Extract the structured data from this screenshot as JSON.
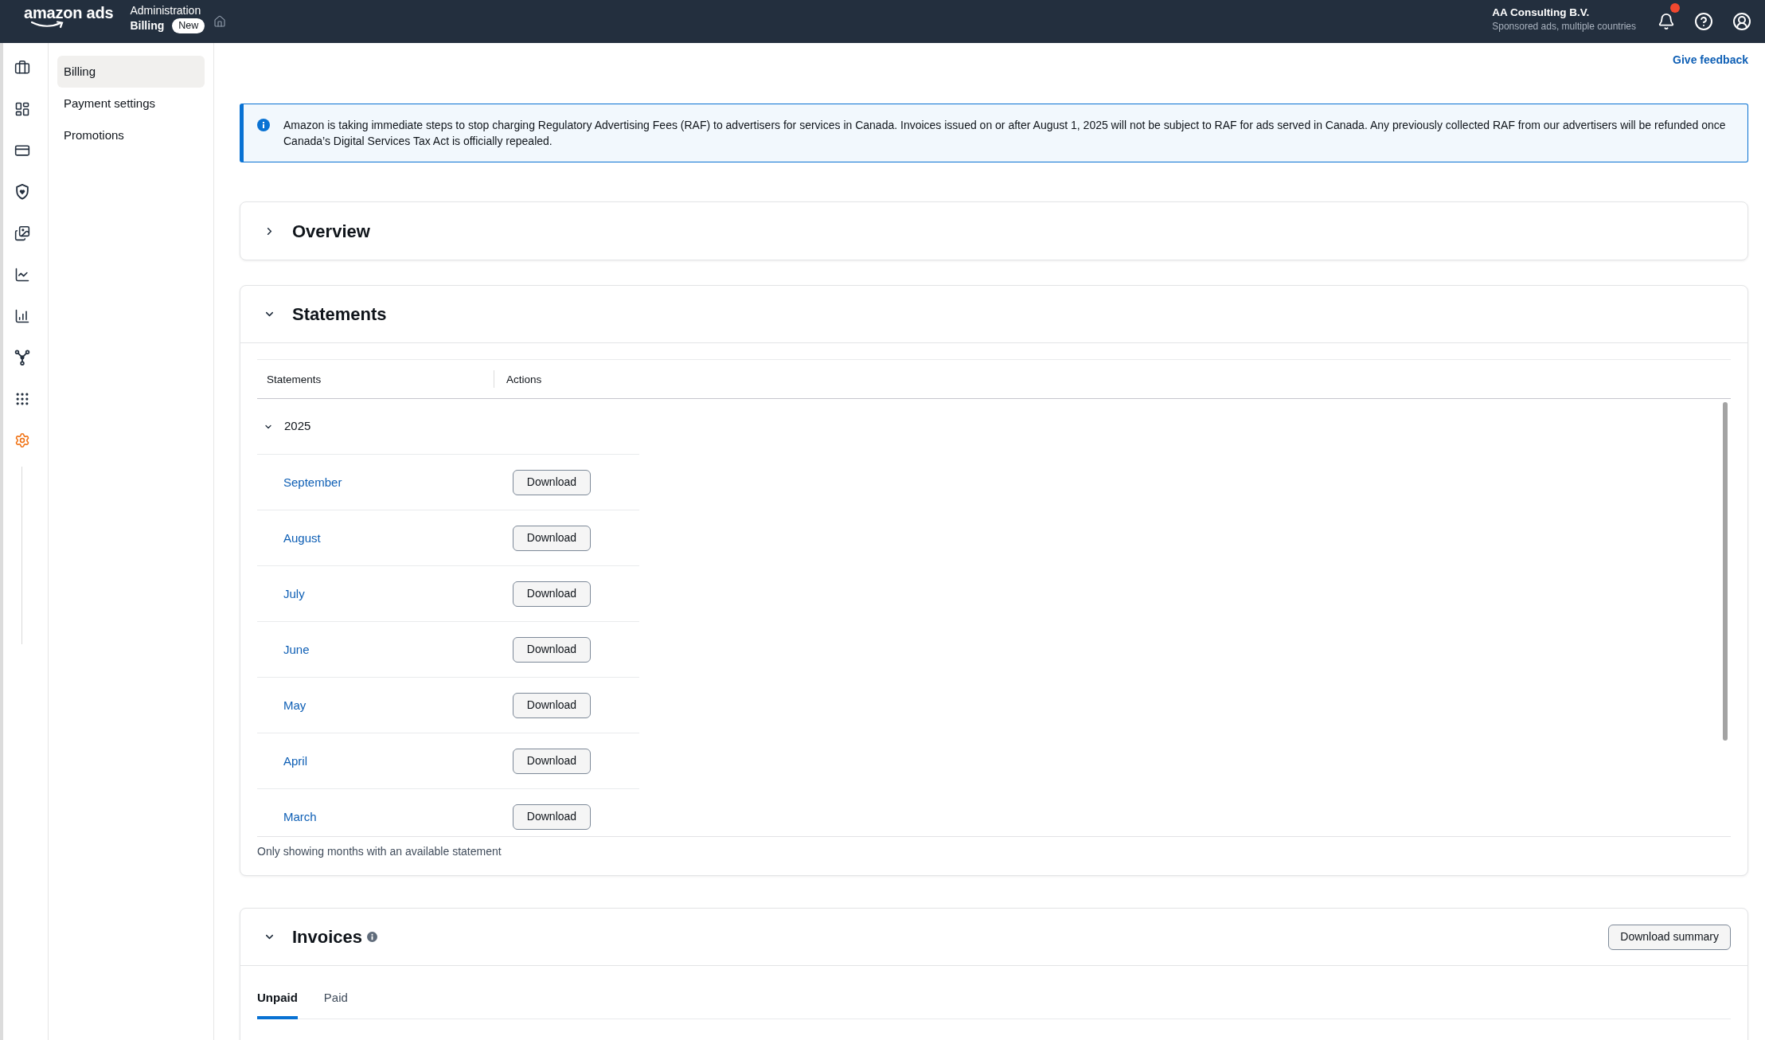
{
  "top_bar": {
    "logo": "amazon ads",
    "section": "Administration",
    "page": "Billing",
    "badge": "New",
    "account_name": "AA Consulting B.V.",
    "account_detail": "Sponsored ads, multiple countries",
    "has_unread_notifications": true
  },
  "icon_rail": [
    {
      "selected": false
    },
    {
      "selected": false
    },
    {
      "selected": false
    },
    {
      "selected": false
    },
    {
      "selected": false
    },
    {
      "selected": false
    },
    {
      "selected": false
    },
    {
      "selected": false
    },
    {
      "selected": false
    },
    {
      "selected": true
    }
  ],
  "nav": [
    {
      "label": "Billing",
      "selected": true
    },
    {
      "label": "Payment settings",
      "selected": false
    },
    {
      "label": "Promotions",
      "selected": false
    }
  ],
  "feedback_link": "Give feedback",
  "notice": "Amazon is taking immediate steps to stop charging Regulatory Advertising Fees (RAF) to advertisers for services in Canada. Invoices issued on or after August 1, 2025 will not be subject to RAF for ads served in Canada. Any previously collected RAF from our advertisers will be refunded once Canada’s Digital Services Tax Act is officially repealed.",
  "overview": {
    "title": "Overview",
    "expanded": false
  },
  "statements": {
    "title": "Statements",
    "expanded": true,
    "columns": [
      "Statements",
      "Actions"
    ],
    "groups": [
      {
        "year": "2025",
        "expanded": true,
        "rows": [
          {
            "month": "September",
            "action": "Download"
          },
          {
            "month": "August",
            "action": "Download"
          },
          {
            "month": "July",
            "action": "Download"
          },
          {
            "month": "June",
            "action": "Download"
          },
          {
            "month": "May",
            "action": "Download"
          },
          {
            "month": "April",
            "action": "Download"
          },
          {
            "month": "March",
            "action": "Download"
          }
        ]
      }
    ],
    "footnote": "Only showing months with an available statement"
  },
  "invoices": {
    "title": "Invoices",
    "expanded": true,
    "button": "Download summary",
    "tabs": [
      {
        "label": "Unpaid",
        "selected": true
      },
      {
        "label": "Paid",
        "selected": false
      }
    ]
  }
}
